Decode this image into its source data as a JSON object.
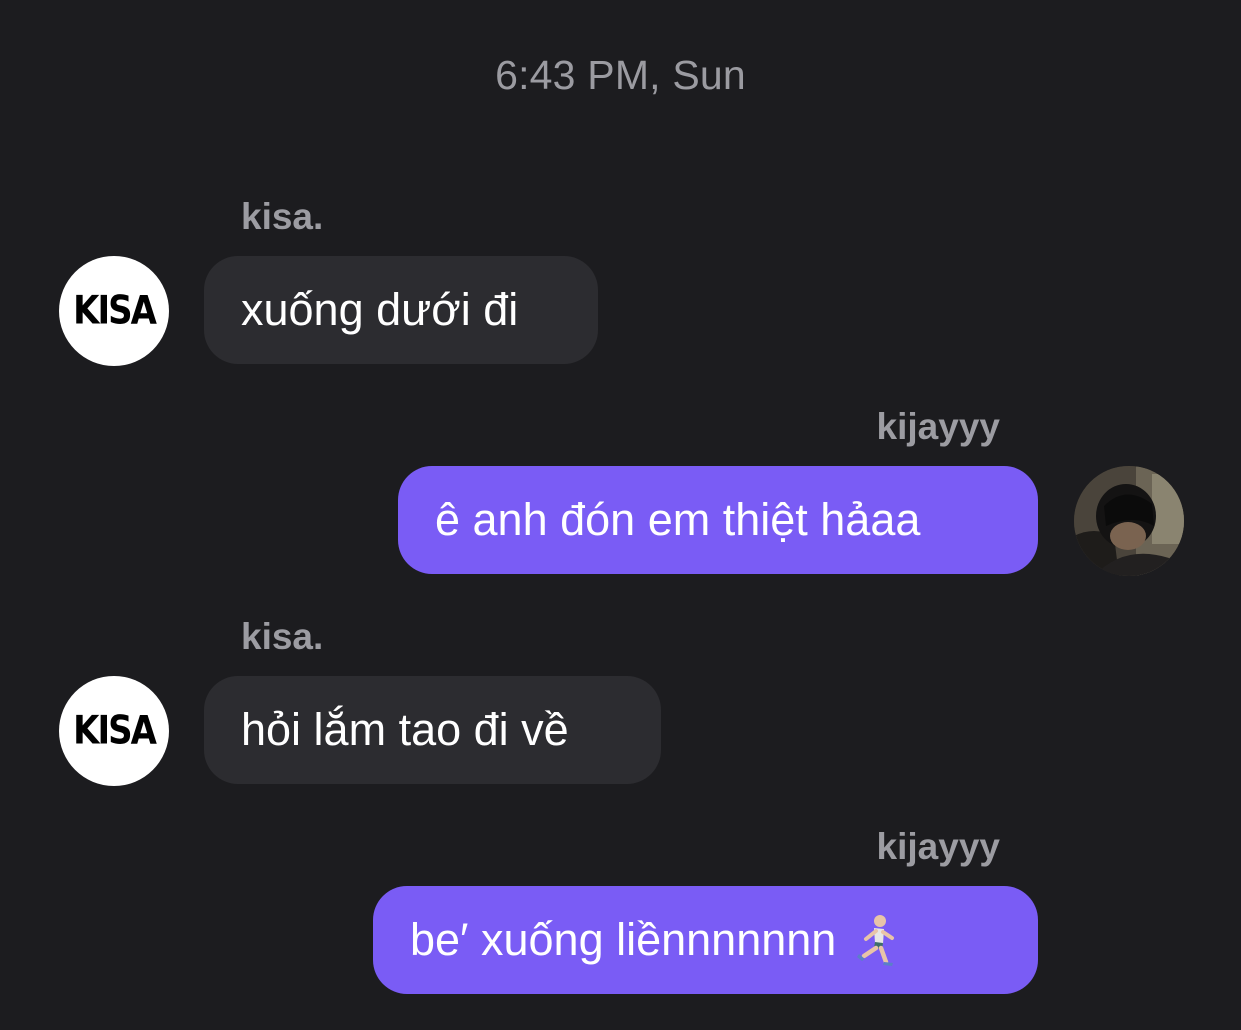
{
  "timestamp": "6:43 PM, Sun",
  "contacts": {
    "other": {
      "name": "kisa.",
      "avatar_text": "KISA"
    },
    "self": {
      "name": "kijayyy"
    }
  },
  "messages": [
    {
      "sender": "kisa.",
      "text": "xuống dưới đi",
      "direction": "incoming"
    },
    {
      "sender": "kijayyy",
      "text": "ê anh đón em thiệt hảaa",
      "direction": "outgoing"
    },
    {
      "sender": "kisa.",
      "text": "hỏi lắm tao đi về",
      "direction": "incoming"
    },
    {
      "sender": "kijayyy",
      "text": "be′ xuống liềnnnnnnn",
      "emoji": "running-person-icon",
      "direction": "outgoing"
    }
  ],
  "colors": {
    "background": "#1c1c1f",
    "incoming_bubble": "#2c2c30",
    "outgoing_bubble": "#7a5cf5",
    "meta_text": "#9b9ba1",
    "message_text": "#ffffff"
  }
}
